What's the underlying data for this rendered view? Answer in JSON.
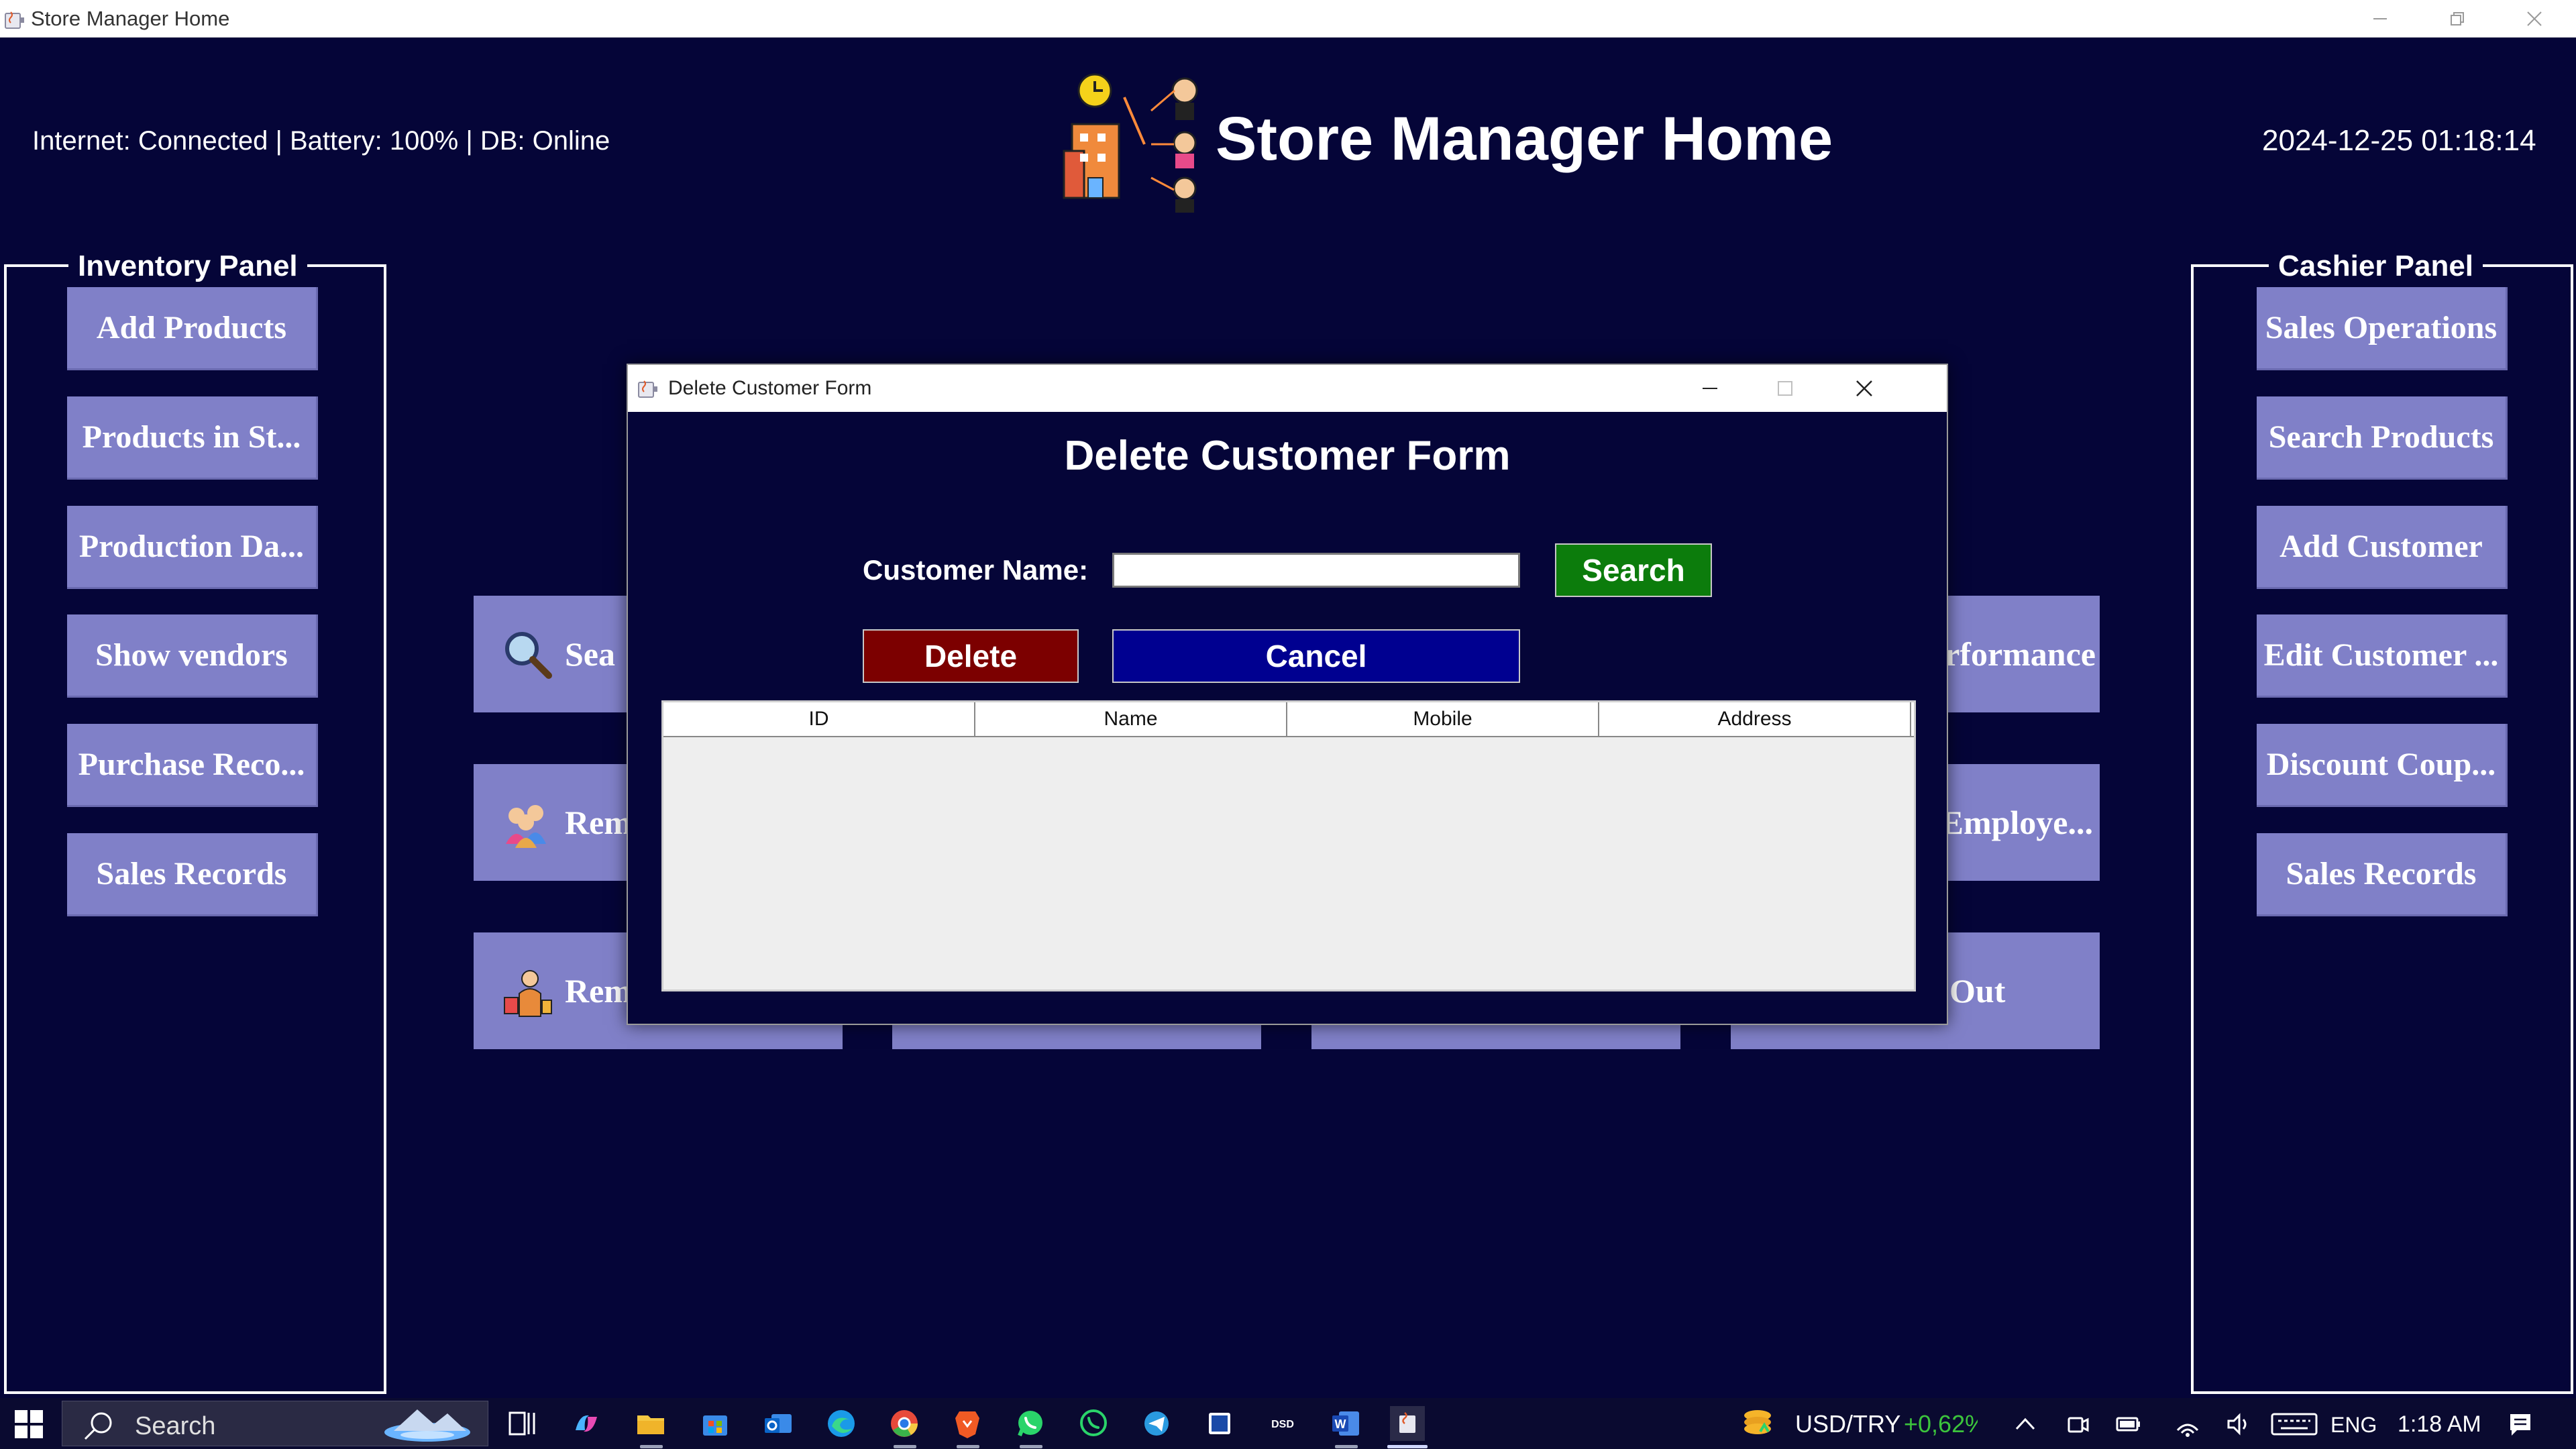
{
  "window": {
    "title": "Store Manager Home"
  },
  "header": {
    "status": "Internet: Connected | Battery: 100% | DB:  Online",
    "title": "Store Manager Home",
    "datetime": "2024-12-25 01:18:14"
  },
  "inventory_panel": {
    "legend": "Inventory Panel",
    "buttons": [
      "Add Products",
      "Products in St...",
      "Production Da...",
      "Show vendors",
      "Purchase Reco...",
      "Sales Records"
    ]
  },
  "cashier_panel": {
    "legend": "Cashier Panel",
    "buttons": [
      "Sales Operations",
      "Search Products",
      "Add Customer",
      "Edit Customer ...",
      "Discount Coup...",
      "Sales Records"
    ]
  },
  "center_buttons": {
    "row1_left": "Sea",
    "row1_right": "rformance",
    "row2_left": "Rem",
    "row2_right": "Employe...",
    "row3_left": "Remo",
    "row3_right": "Out"
  },
  "dialog": {
    "window_title": "Delete Customer Form",
    "heading": "Delete Customer Form",
    "name_label": "Customer Name:",
    "name_value": "",
    "search_label": "Search",
    "delete_label": "Delete",
    "cancel_label": "Cancel",
    "table_columns": [
      "ID",
      "Name",
      "Mobile",
      "Address"
    ],
    "table_rows": []
  },
  "taskbar": {
    "search_placeholder": "Search",
    "ticker_label": "USD/TRY",
    "ticker_change": "+0,62%",
    "language": "ENG",
    "time": "1:18 AM"
  },
  "colors": {
    "background": "#050538",
    "button_purple": "#8080c8",
    "search_green": "#0c7c0c",
    "delete_red": "#7c0000",
    "cancel_blue": "#000090",
    "ticker_green": "#3cc43c"
  }
}
